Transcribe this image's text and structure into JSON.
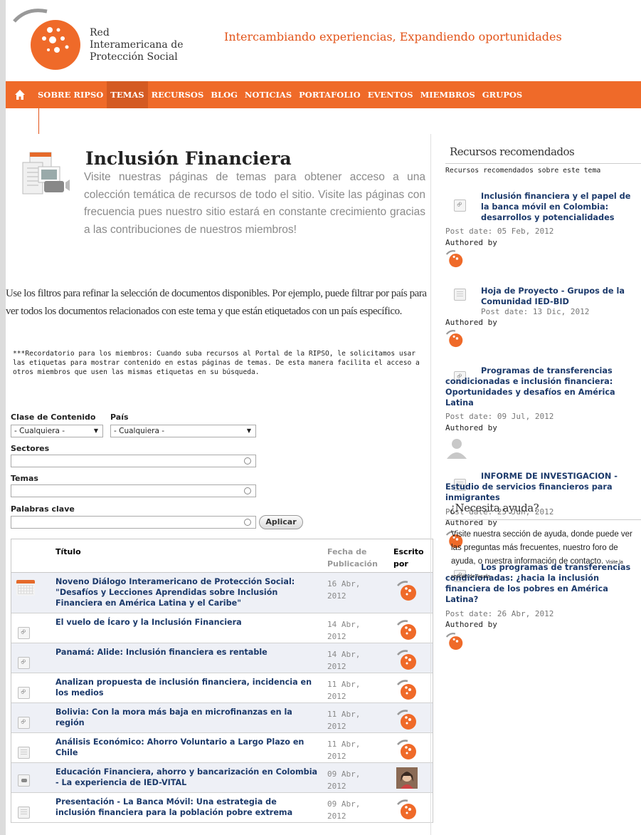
{
  "header": {
    "org_line1": "Red",
    "org_line2": "Interamericana de",
    "org_line3": "Protección Social",
    "tagline": "Intercambiando experiencias, Expandiendo oportunidades"
  },
  "nav": {
    "items": [
      "SOBRE RIPSO",
      "TEMAS",
      "RECURSOS",
      "BLOG",
      "NOTICIAS",
      "PORTAFOLIO",
      "EVENTOS",
      "MIEMBROS",
      "GRUPOS"
    ],
    "active": "TEMAS"
  },
  "main": {
    "title": "Inclusión Financiera",
    "intro": "Visite nuestras páginas de temas para obtener acceso a una colección temática de recursos de todo el sitio. Visite las páginas con frecuencia pues nuestro sitio estará en constante crecimiento gracias a las contribuciones de nuestros miembros!",
    "filters_text": "Use los filtros para refinar la selección de documentos disponibles. Por ejemplo, puede filtrar por país para ver todos los documentos relacionados con este tema y que están etiquetados con un país específico.",
    "reminder": "***Recordatorio para los miembros: Cuando suba recursos al Portal de la RIPSO, le solicitamos usar las etiquetas para mostrar contenido en estas páginas de temas. De esta manera facilita el acceso a otros miembros que usen las mismas etiquetas en su búsqueda."
  },
  "filters": {
    "content_type_label": "Clase de Contenido",
    "content_type_value": "- Cualquiera -",
    "country_label": "País",
    "country_value": "- Cualquiera -",
    "sectors_label": "Sectores",
    "topics_label": "Temas",
    "keywords_label": "Palabras clave",
    "apply_label": "Aplicar"
  },
  "table": {
    "col_title": "Título",
    "col_date": "Fecha de Publicación",
    "col_author": "Escrito por",
    "rows": [
      {
        "title": "Noveno Diálogo Interamericano de Protección Social: \"Desafíos y Lecciones Aprendidas sobre Inclusión Financiera en América Latina y el Caribe\"",
        "date": "16 Abr, 2012",
        "icon": "calendar-icon"
      },
      {
        "title": "El vuelo de Ícaro y la Inclusión Financiera",
        "date": "14 Abr, 2012",
        "icon": "link-icon"
      },
      {
        "title": "Panamá: Alide: Inclusión financiera es rentable",
        "date": "14 Abr, 2012",
        "icon": "link-icon"
      },
      {
        "title": "Analizan propuesta de inclusión financiera, incidencia en los medios",
        "date": "11 Abr, 2012",
        "icon": "link-icon"
      },
      {
        "title": "Bolivia: Con la mora más baja en microfinanzas en la región",
        "date": "11 Abr, 2012",
        "icon": "link-icon"
      },
      {
        "title": "Análisis Económico: Ahorro Voluntario a Largo Plazo en Chile",
        "date": "11 Abr, 2012",
        "icon": "document-icon"
      },
      {
        "title": "Educación Financiera, ahorro y bancarización en Colombia - La experiencia de IED-VITAL",
        "date": "09 Abr, 2012",
        "icon": "video-icon"
      },
      {
        "title": "Presentación - La Banca Móvil: Una estrategia de inclusión financiera para la población pobre extrema",
        "date": "09 Abr, 2012",
        "icon": "document-icon"
      }
    ]
  },
  "sidebar": {
    "recommended_heading": "Recursos recomendados",
    "recommended_sub": "Recursos recomendados sobre este tema",
    "authored_by": "Authored by",
    "resources": [
      {
        "title": "Inclusión financiera y el papel de la banca móvil en Colombia: desarrollos y potencialidades",
        "date": "Post date: 05 Feb, 2012"
      },
      {
        "title": "Hoja de Proyecto - Grupos de la Comunidad IED-BID",
        "date": "Post date: 13 Dic, 2012"
      },
      {
        "title": "Programas de transferencias condicionadas e inclusión financiera: Oportunidades y desafíos en América Latina",
        "date": "Post date: 09 Jul, 2012"
      },
      {
        "title": "INFORME DE INVESTIGACION - Estudio de servicios financieros para inmigrantes",
        "date": "Post date: 25 Jun, 2012"
      },
      {
        "title": "Los programas de transferencias condicionadas: ¿hacia la inclusión financiera de los pobres en América Latina?",
        "date": "Post date: 26 Abr, 2012"
      }
    ],
    "help_heading": "¿Necesita ayuda?",
    "help_text": "Visite nuestra sección de ayuda, donde puede ver las preguntas más frecuentes, nuestro foro de ayuda, o nuestra información de contacto.",
    "help_link": "Visite la sección de Ayuda"
  },
  "colors": {
    "brand_orange": "#ef6a29",
    "link_blue": "#1c3a6b"
  }
}
